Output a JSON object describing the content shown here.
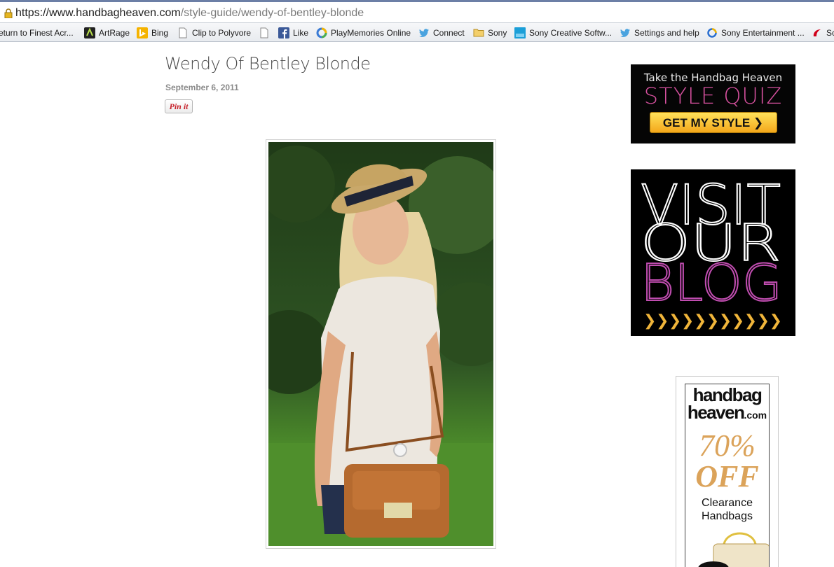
{
  "browser": {
    "url_domain": "https://www.handbagheaven.com",
    "url_path": "/style-guide/wendy-of-bentley-blonde"
  },
  "bookmarks": [
    {
      "label": "eturn to Finest Acr...",
      "icon": "bookmark-icon"
    },
    {
      "label": "ArtRage",
      "icon": "artrage-icon"
    },
    {
      "label": "Bing",
      "icon": "bing-icon"
    },
    {
      "label": "Clip to Polyvore",
      "icon": "page-icon"
    },
    {
      "label": "",
      "icon": "page-icon"
    },
    {
      "label": "Like",
      "icon": "facebook-icon"
    },
    {
      "label": "PlayMemories Online",
      "icon": "playmemories-icon"
    },
    {
      "label": "Connect",
      "icon": "twitter-icon"
    },
    {
      "label": "Sony",
      "icon": "folder-icon"
    },
    {
      "label": "Sony Creative Softw...",
      "icon": "sony-creative-icon"
    },
    {
      "label": "Settings and help",
      "icon": "twitter-icon"
    },
    {
      "label": "Sony Entertainment ...",
      "icon": "sony-entertainment-icon"
    },
    {
      "label": "Sc",
      "icon": "sc-icon"
    }
  ],
  "post": {
    "title": "Wendy Of Bentley Blonde",
    "date": "September 6, 2011",
    "pin_label": "Pin it"
  },
  "ads": {
    "quiz": {
      "line1": "Take the Handbag Heaven",
      "line2": "STYLE QUIZ",
      "button": "GET MY STYLE ❯"
    },
    "blog": {
      "line1": "VISIT",
      "line2": "OUR",
      "line3": "BLOG",
      "arrows": "❯❯❯❯❯❯❯❯❯❯❯"
    },
    "clearance": {
      "logo1": "handbag",
      "logo2": "heaven",
      "logo2_suffix": ".com",
      "percent": "70%",
      "off": "OFF",
      "text1": "Clearance",
      "text2": "Handbags"
    }
  },
  "colors": {
    "accent_pink": "#d7519f",
    "accent_gold": "#dba35a",
    "button_yellow": "#f4a81b"
  }
}
